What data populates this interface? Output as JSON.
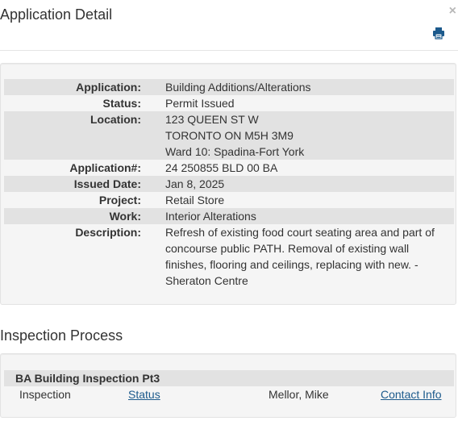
{
  "header": {
    "title": "Application Detail"
  },
  "details": [
    {
      "label": "Application:",
      "lines": [
        "Building Additions/Alterations"
      ]
    },
    {
      "label": "Status:",
      "lines": [
        "Permit Issued"
      ]
    },
    {
      "label": "Location:",
      "lines": [
        "123 QUEEN ST W",
        "TORONTO ON M5H 3M9",
        "Ward 10: Spadina-Fort York"
      ]
    },
    {
      "label": "Application#:",
      "lines": [
        "24 250855 BLD 00 BA"
      ]
    },
    {
      "label": "Issued Date:",
      "lines": [
        "Jan 8, 2025"
      ]
    },
    {
      "label": "Project:",
      "lines": [
        "Retail Store"
      ]
    },
    {
      "label": "Work:",
      "lines": [
        "Interior Alterations"
      ]
    },
    {
      "label": "Description:",
      "lines": [
        "Refresh of existing food court seating area and part of",
        "concourse public PATH. Removal of existing wall",
        "finishes, flooring and ceilings, replacing with new. -",
        "Sheraton Centre"
      ]
    }
  ],
  "inspection": {
    "section_title": "Inspection Process",
    "group_title": "BA Building Inspection Pt3",
    "row": {
      "type": "Inspection",
      "status_link": "Status",
      "inspector": "Mellor, Mike",
      "contact_link": "Contact Info"
    }
  },
  "icons": {
    "close": "close-icon",
    "print": "print-icon"
  },
  "colors": {
    "link": "#1c5a8c",
    "row_alt": "#e2e2e2",
    "panel_bg": "#f5f5f5"
  }
}
